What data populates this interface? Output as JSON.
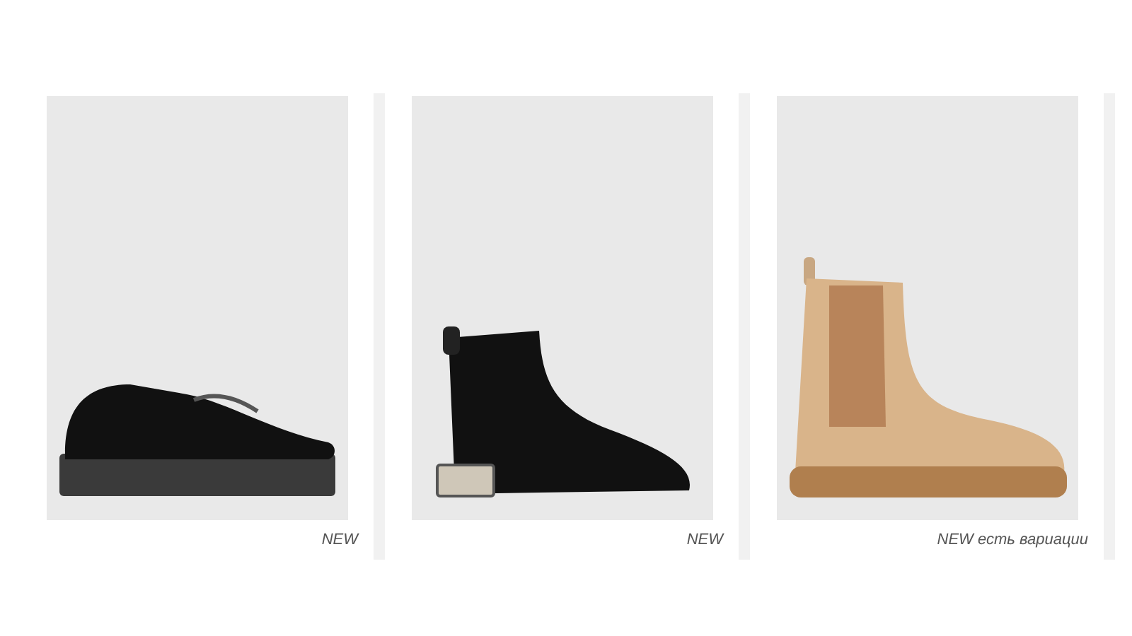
{
  "products": [
    {
      "kind": "loafer",
      "badge": "NEW"
    },
    {
      "kind": "ankle-boot",
      "badge": "NEW"
    },
    {
      "kind": "chelsea-boot",
      "badge": "NEW есть вариации"
    }
  ]
}
